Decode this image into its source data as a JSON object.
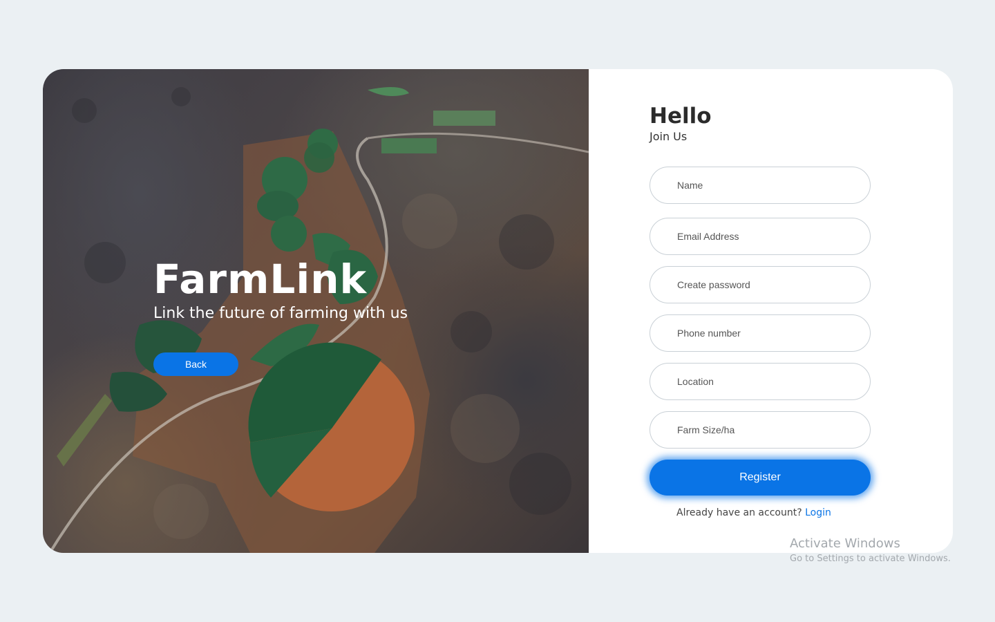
{
  "hero": {
    "brand": "FarmLink",
    "tagline": "Link the future of farming with us",
    "back_label": "Back"
  },
  "form": {
    "greeting": "Hello",
    "subtitle": "Join Us",
    "fields": {
      "name_placeholder": "Name",
      "email_placeholder": "Email Address",
      "password_placeholder": "Create password",
      "phone_placeholder": "Phone number",
      "location_placeholder": "Location",
      "farm_size_placeholder": "Farm Size/ha"
    },
    "register_label": "Register",
    "already_text": "Already have an account?",
    "login_label": "Login"
  },
  "watermark": {
    "title": "Activate Windows",
    "subtitle": "Go to Settings to activate Windows."
  },
  "colors": {
    "accent": "#0a74e6",
    "background": "#ebf0f3"
  }
}
